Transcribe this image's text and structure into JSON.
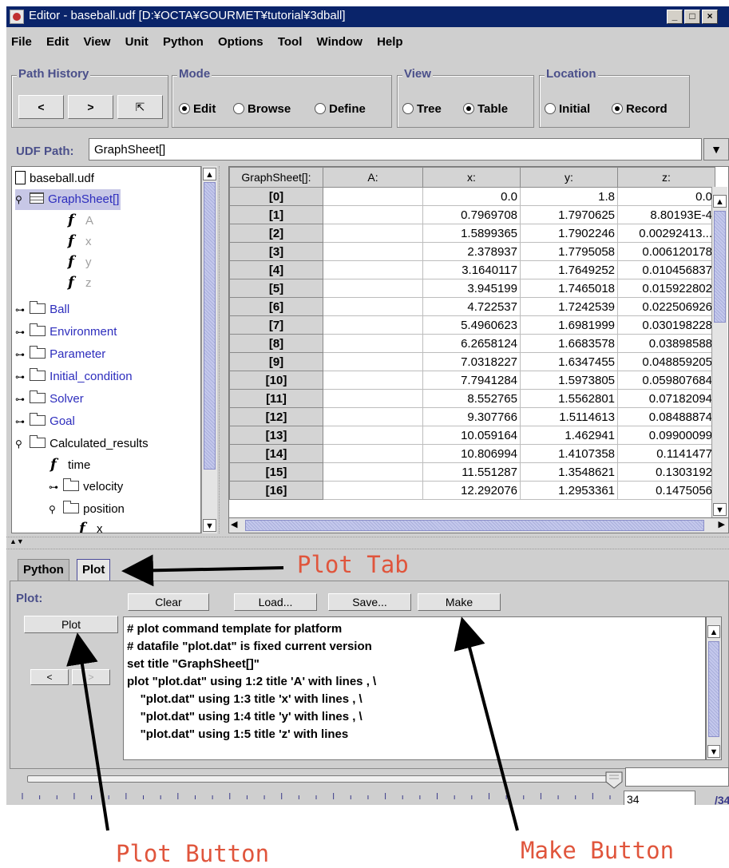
{
  "window": {
    "title": "Editor - baseball.udf [D:¥OCTA¥GOURMET¥tutorial¥3dball]",
    "controls": [
      "_",
      "□",
      "×"
    ]
  },
  "menu": [
    "File",
    "Edit",
    "View",
    "Unit",
    "Python",
    "Options",
    "Tool",
    "Window",
    "Help"
  ],
  "path_history": {
    "label": "Path History",
    "back": "<",
    "forward": ">",
    "jump": "⇱"
  },
  "mode": {
    "label": "Mode",
    "options": [
      "Edit",
      "Browse",
      "Define"
    ],
    "selected": "Edit"
  },
  "view": {
    "label": "View",
    "options": [
      "Tree",
      "Table"
    ],
    "selected": "Table"
  },
  "location": {
    "label": "Location",
    "options": [
      "Initial",
      "Record"
    ],
    "selected": "Record"
  },
  "udf_path": {
    "label": "UDF Path:",
    "value": "GraphSheet[]"
  },
  "tree": {
    "root": "baseball.udf",
    "items": [
      {
        "label": "GraphSheet[]",
        "icon": "grid-icon"
      },
      {
        "label": "A",
        "icon": "function-icon"
      },
      {
        "label": "x",
        "icon": "function-icon"
      },
      {
        "label": "y",
        "icon": "function-icon"
      },
      {
        "label": "z",
        "icon": "function-icon"
      },
      {
        "label": "Ball",
        "icon": "folder-icon"
      },
      {
        "label": "Environment",
        "icon": "folder-icon"
      },
      {
        "label": "Parameter",
        "icon": "folder-icon"
      },
      {
        "label": "Initial_condition",
        "icon": "folder-icon"
      },
      {
        "label": "Solver",
        "icon": "folder-icon"
      },
      {
        "label": "Goal",
        "icon": "folder-icon"
      },
      {
        "label": "Calculated_results",
        "icon": "folder-icon"
      },
      {
        "label": "time",
        "icon": "function-icon"
      },
      {
        "label": "velocity",
        "icon": "folder-icon"
      },
      {
        "label": "position",
        "icon": "folder-icon"
      },
      {
        "label": "x",
        "icon": "function-icon"
      }
    ]
  },
  "table": {
    "columns": [
      "GraphSheet[]:",
      "A:",
      "x:",
      "y:",
      "z:"
    ],
    "rows": [
      [
        "[0]",
        "",
        "0.0",
        "1.8",
        "0.0"
      ],
      [
        "[1]",
        "",
        "0.7969708",
        "1.7970625",
        "8.80193E-4"
      ],
      [
        "[2]",
        "",
        "1.5899365",
        "1.7902246",
        "0.00292413..."
      ],
      [
        "[3]",
        "",
        "2.378937",
        "1.7795058",
        "0.006120178"
      ],
      [
        "[4]",
        "",
        "3.1640117",
        "1.7649252",
        "0.010456837"
      ],
      [
        "[5]",
        "",
        "3.945199",
        "1.7465018",
        "0.015922802"
      ],
      [
        "[6]",
        "",
        "4.722537",
        "1.7242539",
        "0.022506926"
      ],
      [
        "[7]",
        "",
        "5.4960623",
        "1.6981999",
        "0.030198228"
      ],
      [
        "[8]",
        "",
        "6.2658124",
        "1.6683578",
        "0.03898588"
      ],
      [
        "[9]",
        "",
        "7.0318227",
        "1.6347455",
        "0.048859205"
      ],
      [
        "[10]",
        "",
        "7.7941284",
        "1.5973805",
        "0.059807684"
      ],
      [
        "[11]",
        "",
        "8.552765",
        "1.5562801",
        "0.07182094"
      ],
      [
        "[12]",
        "",
        "9.307766",
        "1.5114613",
        "0.08488874"
      ],
      [
        "[13]",
        "",
        "10.059164",
        "1.462941",
        "0.09900099"
      ],
      [
        "[14]",
        "",
        "10.806994",
        "1.4107358",
        "0.1141477"
      ],
      [
        "[15]",
        "",
        "11.551287",
        "1.3548621",
        "0.1303192"
      ],
      [
        "[16]",
        "",
        "12.292076",
        "1.2953361",
        "0.1475056"
      ]
    ]
  },
  "tabs": [
    "Python",
    "Plot"
  ],
  "plot_panel": {
    "label": "Plot:",
    "buttons": {
      "clear": "Clear",
      "load": "Load...",
      "save": "Save...",
      "make": "Make",
      "plot": "Plot",
      "prev": "<",
      "next": ">"
    },
    "script_lines": [
      "# plot command template for platform",
      "# datafile \"plot.dat\" is fixed current version",
      "set title \"GraphSheet[]\"",
      "plot \"plot.dat\" using 1:2 title 'A' with lines , \\",
      "    \"plot.dat\" using 1:3 title 'x' with lines , \\",
      "    \"plot.dat\" using 1:4 title 'y' with lines , \\",
      "    \"plot.dat\" using 1:5 title 'z' with lines"
    ]
  },
  "slider": {
    "ticks": [
      "0",
      "3",
      "6",
      "9",
      "12",
      "15",
      "18",
      "21",
      "24",
      "27",
      "30",
      "33"
    ],
    "value": "34",
    "total": "/34",
    "position_fraction": 1.0
  },
  "annotations": {
    "plot_tab": "Plot Tab",
    "plot_button": "Plot Button",
    "make_button": "Make Button"
  },
  "colors": {
    "accent_label": "#4a4f8a",
    "tree_link": "#2d2dbd",
    "annotation": "#e0553c",
    "titlebar": "#0a246a"
  }
}
